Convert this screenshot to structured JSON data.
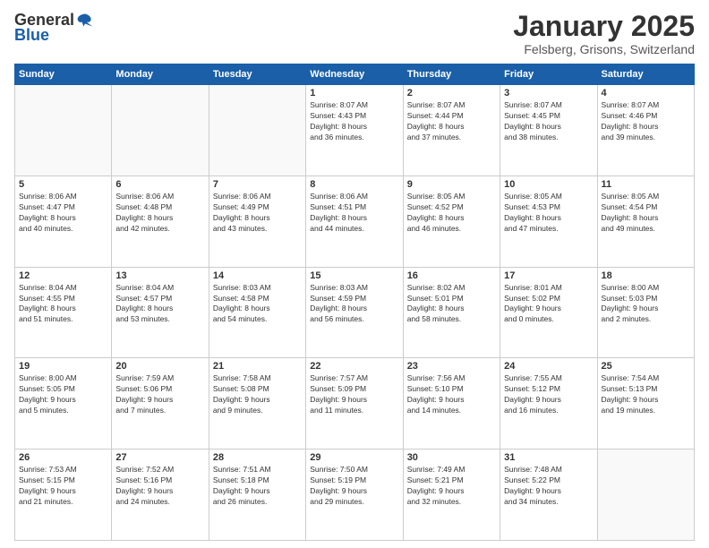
{
  "header": {
    "logo_general": "General",
    "logo_blue": "Blue",
    "month_title": "January 2025",
    "location": "Felsberg, Grisons, Switzerland"
  },
  "days_of_week": [
    "Sunday",
    "Monday",
    "Tuesday",
    "Wednesday",
    "Thursday",
    "Friday",
    "Saturday"
  ],
  "weeks": [
    [
      {
        "day": "",
        "info": ""
      },
      {
        "day": "",
        "info": ""
      },
      {
        "day": "",
        "info": ""
      },
      {
        "day": "1",
        "info": "Sunrise: 8:07 AM\nSunset: 4:43 PM\nDaylight: 8 hours\nand 36 minutes."
      },
      {
        "day": "2",
        "info": "Sunrise: 8:07 AM\nSunset: 4:44 PM\nDaylight: 8 hours\nand 37 minutes."
      },
      {
        "day": "3",
        "info": "Sunrise: 8:07 AM\nSunset: 4:45 PM\nDaylight: 8 hours\nand 38 minutes."
      },
      {
        "day": "4",
        "info": "Sunrise: 8:07 AM\nSunset: 4:46 PM\nDaylight: 8 hours\nand 39 minutes."
      }
    ],
    [
      {
        "day": "5",
        "info": "Sunrise: 8:06 AM\nSunset: 4:47 PM\nDaylight: 8 hours\nand 40 minutes."
      },
      {
        "day": "6",
        "info": "Sunrise: 8:06 AM\nSunset: 4:48 PM\nDaylight: 8 hours\nand 42 minutes."
      },
      {
        "day": "7",
        "info": "Sunrise: 8:06 AM\nSunset: 4:49 PM\nDaylight: 8 hours\nand 43 minutes."
      },
      {
        "day": "8",
        "info": "Sunrise: 8:06 AM\nSunset: 4:51 PM\nDaylight: 8 hours\nand 44 minutes."
      },
      {
        "day": "9",
        "info": "Sunrise: 8:05 AM\nSunset: 4:52 PM\nDaylight: 8 hours\nand 46 minutes."
      },
      {
        "day": "10",
        "info": "Sunrise: 8:05 AM\nSunset: 4:53 PM\nDaylight: 8 hours\nand 47 minutes."
      },
      {
        "day": "11",
        "info": "Sunrise: 8:05 AM\nSunset: 4:54 PM\nDaylight: 8 hours\nand 49 minutes."
      }
    ],
    [
      {
        "day": "12",
        "info": "Sunrise: 8:04 AM\nSunset: 4:55 PM\nDaylight: 8 hours\nand 51 minutes."
      },
      {
        "day": "13",
        "info": "Sunrise: 8:04 AM\nSunset: 4:57 PM\nDaylight: 8 hours\nand 53 minutes."
      },
      {
        "day": "14",
        "info": "Sunrise: 8:03 AM\nSunset: 4:58 PM\nDaylight: 8 hours\nand 54 minutes."
      },
      {
        "day": "15",
        "info": "Sunrise: 8:03 AM\nSunset: 4:59 PM\nDaylight: 8 hours\nand 56 minutes."
      },
      {
        "day": "16",
        "info": "Sunrise: 8:02 AM\nSunset: 5:01 PM\nDaylight: 8 hours\nand 58 minutes."
      },
      {
        "day": "17",
        "info": "Sunrise: 8:01 AM\nSunset: 5:02 PM\nDaylight: 9 hours\nand 0 minutes."
      },
      {
        "day": "18",
        "info": "Sunrise: 8:00 AM\nSunset: 5:03 PM\nDaylight: 9 hours\nand 2 minutes."
      }
    ],
    [
      {
        "day": "19",
        "info": "Sunrise: 8:00 AM\nSunset: 5:05 PM\nDaylight: 9 hours\nand 5 minutes."
      },
      {
        "day": "20",
        "info": "Sunrise: 7:59 AM\nSunset: 5:06 PM\nDaylight: 9 hours\nand 7 minutes."
      },
      {
        "day": "21",
        "info": "Sunrise: 7:58 AM\nSunset: 5:08 PM\nDaylight: 9 hours\nand 9 minutes."
      },
      {
        "day": "22",
        "info": "Sunrise: 7:57 AM\nSunset: 5:09 PM\nDaylight: 9 hours\nand 11 minutes."
      },
      {
        "day": "23",
        "info": "Sunrise: 7:56 AM\nSunset: 5:10 PM\nDaylight: 9 hours\nand 14 minutes."
      },
      {
        "day": "24",
        "info": "Sunrise: 7:55 AM\nSunset: 5:12 PM\nDaylight: 9 hours\nand 16 minutes."
      },
      {
        "day": "25",
        "info": "Sunrise: 7:54 AM\nSunset: 5:13 PM\nDaylight: 9 hours\nand 19 minutes."
      }
    ],
    [
      {
        "day": "26",
        "info": "Sunrise: 7:53 AM\nSunset: 5:15 PM\nDaylight: 9 hours\nand 21 minutes."
      },
      {
        "day": "27",
        "info": "Sunrise: 7:52 AM\nSunset: 5:16 PM\nDaylight: 9 hours\nand 24 minutes."
      },
      {
        "day": "28",
        "info": "Sunrise: 7:51 AM\nSunset: 5:18 PM\nDaylight: 9 hours\nand 26 minutes."
      },
      {
        "day": "29",
        "info": "Sunrise: 7:50 AM\nSunset: 5:19 PM\nDaylight: 9 hours\nand 29 minutes."
      },
      {
        "day": "30",
        "info": "Sunrise: 7:49 AM\nSunset: 5:21 PM\nDaylight: 9 hours\nand 32 minutes."
      },
      {
        "day": "31",
        "info": "Sunrise: 7:48 AM\nSunset: 5:22 PM\nDaylight: 9 hours\nand 34 minutes."
      },
      {
        "day": "",
        "info": ""
      }
    ]
  ]
}
